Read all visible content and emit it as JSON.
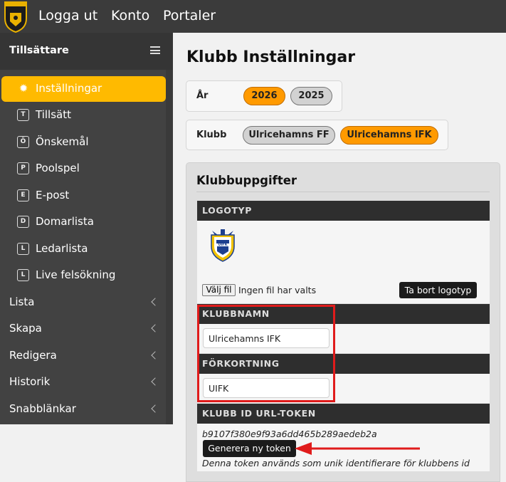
{
  "topbar": {
    "nav": [
      "Logga ut",
      "Konto",
      "Portaler"
    ]
  },
  "sidebar": {
    "title": "Tillsättare",
    "items": [
      {
        "label": "Inställningar",
        "icon": "gear-icon",
        "active": true
      },
      {
        "label": "Tillsätt",
        "icon_letter": "T"
      },
      {
        "label": "Önskemål",
        "icon_letter": "Ö"
      },
      {
        "label": "Poolspel",
        "icon_letter": "P"
      },
      {
        "label": "E-post",
        "icon_letter": "E"
      },
      {
        "label": "Domarlista",
        "icon_letter": "D"
      },
      {
        "label": "Ledarlista",
        "icon_letter": "L"
      },
      {
        "label": "Live felsökning",
        "icon_letter": "L"
      }
    ],
    "groups": [
      "Lista",
      "Skapa",
      "Redigera",
      "Historik",
      "Snabblänkar"
    ]
  },
  "main": {
    "title": "Klubb Inställningar",
    "year_filter": {
      "label": "År",
      "options": [
        "2026",
        "2025"
      ],
      "selected": "2026"
    },
    "club_filter": {
      "label": "Klubb",
      "options": [
        "Ulricehamns FF",
        "Ulricehamns IFK"
      ],
      "selected": "Ulricehamns IFK"
    },
    "card": {
      "title": "Klubbuppgifter",
      "logo_section": {
        "header": "LOGOTYP",
        "file_button": "Välj fil",
        "file_status": "Ingen fil har valts",
        "remove_button": "Ta bort logotyp",
        "logo_text": "UIFK"
      },
      "name_section": {
        "header": "KLUBBNAMN",
        "value": "Ulricehamns IFK"
      },
      "abbr_section": {
        "header": "FÖRKORTNING",
        "value": "UIFK"
      },
      "token_section": {
        "header": "KLUBB ID URL-TOKEN",
        "token": "b9107f380e9f93a6dd465b289aedeb2a",
        "generate_button": "Generera ny token",
        "help": "Denna token används som unik identifierare för klubbens id"
      }
    }
  },
  "colors": {
    "accent": "#ffba00",
    "pill_selected": "#ff9a00",
    "topbar": "#3b3b3b",
    "sidebar": "#424242",
    "annotation": "#e01b1b"
  }
}
